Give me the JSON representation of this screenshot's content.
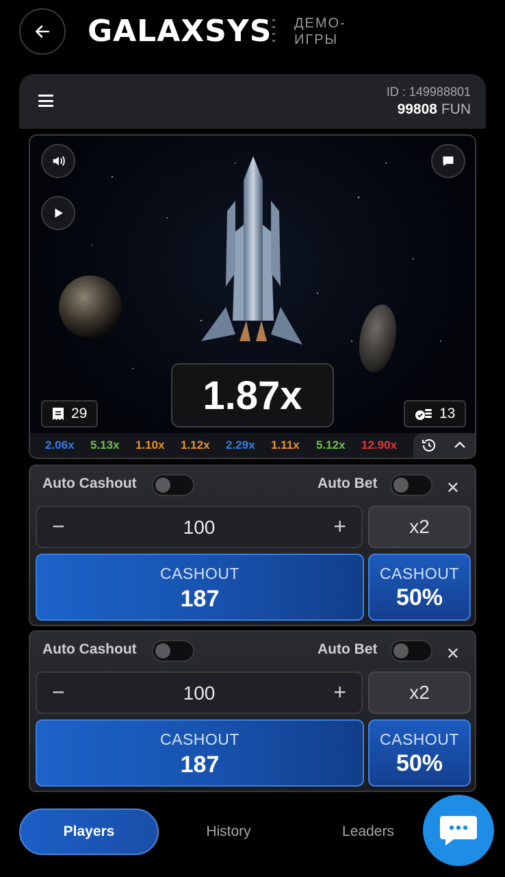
{
  "header": {
    "back_icon": "arrow-left-icon",
    "logo": "GALAXSYS",
    "demo_label_line1": "ДЕМО-",
    "demo_label_line2": "ИГРЫ"
  },
  "account": {
    "id_text": "ID : 149988801",
    "balance": "99808",
    "currency": "FUN"
  },
  "game": {
    "multiplier": "1.87x",
    "bets_count": "29",
    "players_count": "13",
    "history": [
      {
        "value": "2.06x",
        "color": "#2f7fe8"
      },
      {
        "value": "5.13x",
        "color": "#6cc24a"
      },
      {
        "value": "1.10x",
        "color": "#e8932a"
      },
      {
        "value": "1.12x",
        "color": "#e8932a"
      },
      {
        "value": "2.29x",
        "color": "#2f7fe8"
      },
      {
        "value": "1.11x",
        "color": "#e8932a"
      },
      {
        "value": "5.12x",
        "color": "#6cc24a"
      },
      {
        "value": "12.90x",
        "color": "#e63535"
      }
    ]
  },
  "panels": [
    {
      "auto_cashout_label": "Auto Cashout",
      "auto_bet_label": "Auto Bet",
      "amount": "100",
      "double_label": "x2",
      "cashout_label": "CASHOUT",
      "cashout_value": "187",
      "half_label": "CASHOUT",
      "half_value": "50%"
    },
    {
      "auto_cashout_label": "Auto Cashout",
      "auto_bet_label": "Auto Bet",
      "amount": "100",
      "double_label": "x2",
      "cashout_label": "CASHOUT",
      "cashout_value": "187",
      "half_label": "CASHOUT",
      "half_value": "50%"
    }
  ],
  "tabs": [
    {
      "label": "Players",
      "active": true
    },
    {
      "label": "History",
      "active": false
    },
    {
      "label": "Leaders",
      "active": false
    }
  ],
  "colors": {
    "accent_blue": "#1c63c8",
    "background": "#000000"
  }
}
